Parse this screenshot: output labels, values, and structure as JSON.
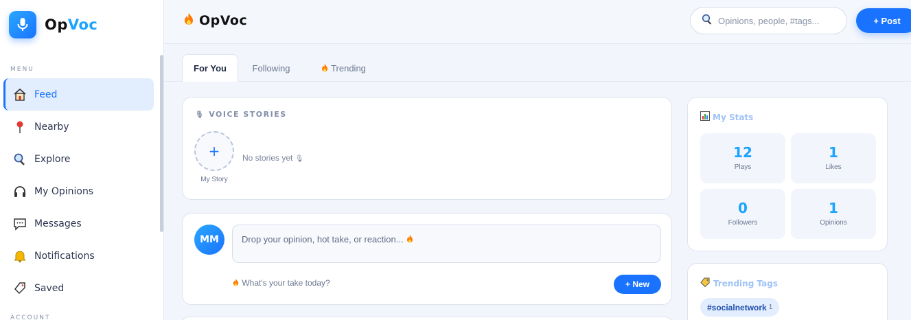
{
  "brand": {
    "name_main": "Op",
    "name_accent": "Voc",
    "header_name": "OpVoc"
  },
  "colors": {
    "accent": "#1a73ff",
    "accent_light": "#1aa3ff",
    "active_bg": "#e2edfd"
  },
  "sidebar": {
    "menu_label": "MENU",
    "account_label": "ACCOUNT",
    "items": [
      {
        "label": "Feed",
        "icon": "house-icon",
        "active": true
      },
      {
        "label": "Nearby",
        "icon": "pin-icon"
      },
      {
        "label": "Explore",
        "icon": "magnifier-icon"
      },
      {
        "label": "My Opinions",
        "icon": "headphones-icon"
      },
      {
        "label": "Messages",
        "icon": "speech-bubble-icon"
      },
      {
        "label": "Notifications",
        "icon": "bell-icon"
      },
      {
        "label": "Saved",
        "icon": "bookmark-tag-icon"
      }
    ]
  },
  "header": {
    "search_placeholder": "Opinions, people, #tags...",
    "post_label": "+ Post"
  },
  "tabs": [
    {
      "label": "For You",
      "active": true
    },
    {
      "label": "Following"
    },
    {
      "label": "Trending",
      "icon": "fire-icon"
    }
  ],
  "stories": {
    "title": "VOICE STORIES",
    "add_label": "+",
    "my_story_label": "My Story",
    "empty_text": "No stories yet"
  },
  "composer": {
    "avatar_initials": "MM",
    "placeholder": "Drop your opinion, hot take, or reaction...",
    "prompt": "What's your take today?",
    "new_label": "+ New"
  },
  "stats": {
    "title": "My Stats",
    "items": [
      {
        "value": "12",
        "label": "Plays"
      },
      {
        "value": "1",
        "label": "Likes"
      },
      {
        "value": "0",
        "label": "Followers"
      },
      {
        "value": "1",
        "label": "Opinions"
      }
    ]
  },
  "trending_tags": {
    "title": "Trending Tags",
    "tags": [
      {
        "name": "#socialnetwork",
        "count": "1"
      }
    ]
  }
}
